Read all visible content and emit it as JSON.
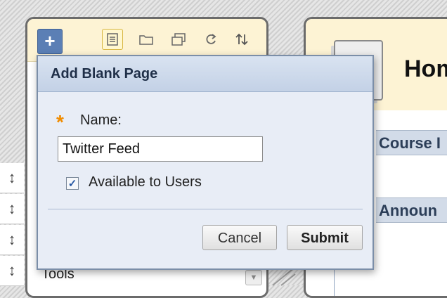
{
  "dialog": {
    "title": "Add Blank Page",
    "name_label": "Name:",
    "name_value": "Twitter Feed",
    "available_label": "Available to Users",
    "available_checked": true,
    "cancel_label": "Cancel",
    "submit_label": "Submit"
  },
  "menu": {
    "add_symbol": "+",
    "last_item_label": "Tools",
    "toolbar_icons": [
      "page-icon",
      "folder-icon",
      "window-icon",
      "refresh-icon",
      "sort-icon"
    ]
  },
  "content": {
    "page_title": "Hom",
    "course_bar": "Course I",
    "announcements_bar": "Announ"
  },
  "colors": {
    "required_star": "#f08c00",
    "add_button": "#5b7fb5",
    "toolbar_bg": "#fdf3d4",
    "dialog_bg": "#e8edf6"
  }
}
